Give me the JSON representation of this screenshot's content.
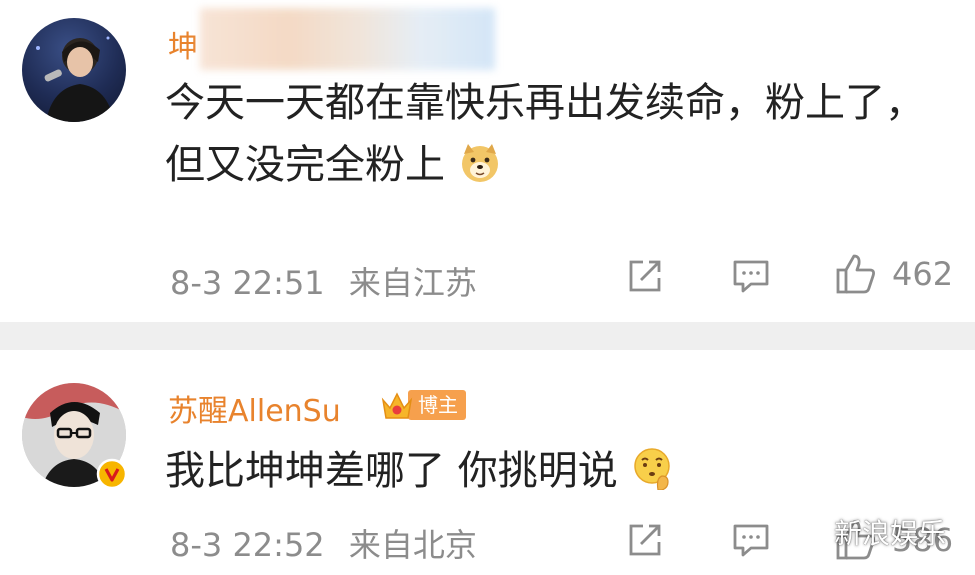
{
  "comments": [
    {
      "username": "坤",
      "text_line1": "今天一天都在靠快乐再出发续命，粉上了，",
      "text_line2": "但又没完全粉上",
      "emoji": "doge-emoji",
      "time": "8-3 22:51",
      "location": "来自江苏",
      "likes": "462"
    },
    {
      "username": "苏醒AllenSu",
      "badge": "博主",
      "text": "我比坤坤差哪了 你挑明说",
      "emoji": "thinking-face-emoji",
      "time": "8-3 22:52",
      "location": "来自北京",
      "likes": "586"
    }
  ],
  "watermark": "新浪娱乐",
  "colors": {
    "username": "#e8832d",
    "badge": "#f6a04d",
    "meta_text": "#8c8c8c",
    "divider": "#efefef"
  }
}
